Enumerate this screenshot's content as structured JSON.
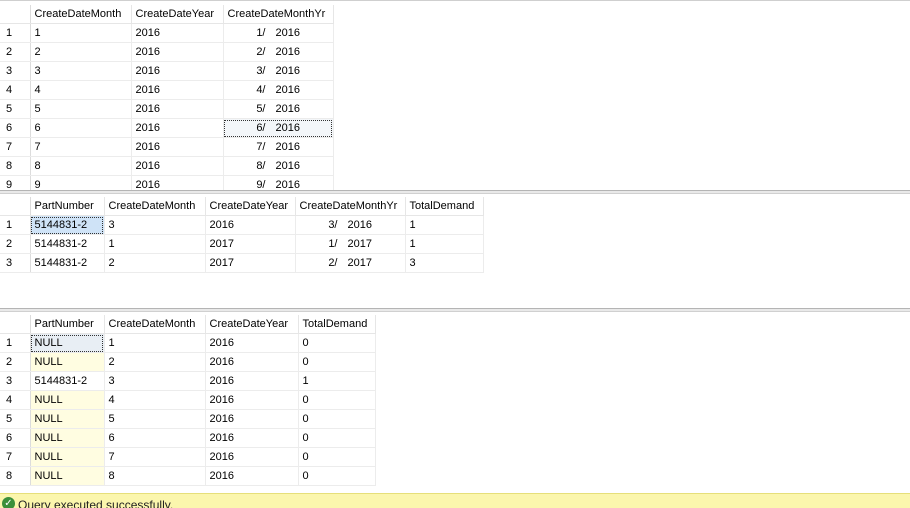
{
  "results": [
    {
      "columns": [
        "CreateDateMonth",
        "CreateDateYear",
        "CreateDateMonthYr"
      ],
      "rows": [
        {
          "n": "1",
          "month": "1",
          "year": "2016",
          "myr_m": "1/",
          "myr_y": "2016"
        },
        {
          "n": "2",
          "month": "2",
          "year": "2016",
          "myr_m": "2/",
          "myr_y": "2016"
        },
        {
          "n": "3",
          "month": "3",
          "year": "2016",
          "myr_m": "3/",
          "myr_y": "2016"
        },
        {
          "n": "4",
          "month": "4",
          "year": "2016",
          "myr_m": "4/",
          "myr_y": "2016"
        },
        {
          "n": "5",
          "month": "5",
          "year": "2016",
          "myr_m": "5/",
          "myr_y": "2016"
        },
        {
          "n": "6",
          "month": "6",
          "year": "2016",
          "myr_m": "6/",
          "myr_y": "2016"
        },
        {
          "n": "7",
          "month": "7",
          "year": "2016",
          "myr_m": "7/",
          "myr_y": "2016"
        },
        {
          "n": "8",
          "month": "8",
          "year": "2016",
          "myr_m": "8/",
          "myr_y": "2016"
        },
        {
          "n": "9",
          "month": "9",
          "year": "2016",
          "myr_m": "9/",
          "myr_y": "2016"
        }
      ]
    },
    {
      "columns": [
        "PartNumber",
        "CreateDateMonth",
        "CreateDateYear",
        "CreateDateMonthYr",
        "TotalDemand"
      ],
      "rows": [
        {
          "n": "1",
          "part": "5144831-2",
          "month": "3",
          "year": "2016",
          "myr_m": "3/",
          "myr_y": "2016",
          "demand": "1"
        },
        {
          "n": "2",
          "part": "5144831-2",
          "month": "1",
          "year": "2017",
          "myr_m": "1/",
          "myr_y": "2017",
          "demand": "1"
        },
        {
          "n": "3",
          "part": "5144831-2",
          "month": "2",
          "year": "2017",
          "myr_m": "2/",
          "myr_y": "2017",
          "demand": "3"
        }
      ]
    },
    {
      "columns": [
        "PartNumber",
        "CreateDateMonth",
        "CreateDateYear",
        "TotalDemand"
      ],
      "rows": [
        {
          "n": "1",
          "part": "NULL",
          "month": "1",
          "year": "2016",
          "demand": "0"
        },
        {
          "n": "2",
          "part": "NULL",
          "month": "2",
          "year": "2016",
          "demand": "0"
        },
        {
          "n": "3",
          "part": "5144831-2",
          "month": "3",
          "year": "2016",
          "demand": "1"
        },
        {
          "n": "4",
          "part": "NULL",
          "month": "4",
          "year": "2016",
          "demand": "0"
        },
        {
          "n": "5",
          "part": "NULL",
          "month": "5",
          "year": "2016",
          "demand": "0"
        },
        {
          "n": "6",
          "part": "NULL",
          "month": "6",
          "year": "2016",
          "demand": "0"
        },
        {
          "n": "7",
          "part": "NULL",
          "month": "7",
          "year": "2016",
          "demand": "0"
        },
        {
          "n": "8",
          "part": "NULL",
          "month": "8",
          "year": "2016",
          "demand": "0"
        }
      ]
    }
  ],
  "status": {
    "text": "Query executed successfully.",
    "icon": "check-circle-icon",
    "color": "#fbf6ad"
  },
  "colors": {
    "selected_cell": "#cfe3f7",
    "null_cell": "#fffde1"
  }
}
